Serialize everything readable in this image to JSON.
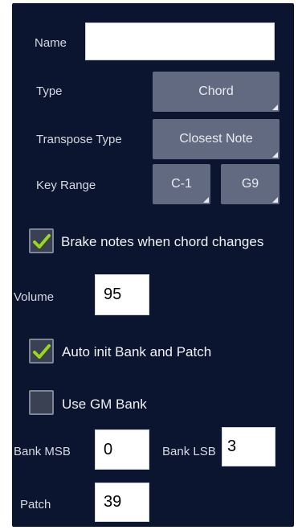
{
  "fields": {
    "name_label": "Name",
    "name_value": "",
    "type_label": "Type",
    "type_value": "Chord",
    "transpose_label": "Transpose Type",
    "transpose_value": "Closest Note",
    "key_range_label": "Key Range",
    "key_range_low": "C-1",
    "key_range_high": "G9"
  },
  "options": {
    "brake_notes_label": "Brake notes when chord changes",
    "brake_notes_checked": true,
    "auto_init_label": "Auto init Bank and Patch",
    "auto_init_checked": true,
    "use_gm_label": "Use GM Bank",
    "use_gm_checked": false
  },
  "values": {
    "volume_label": "Volume",
    "volume_value": "95",
    "bank_msb_label": "Bank MSB",
    "bank_msb_value": "0",
    "bank_lsb_label": "Bank LSB",
    "bank_lsb_value": "3",
    "patch_label": "Patch",
    "patch_value": "39"
  },
  "colors": {
    "panel_bg": "#0b1530",
    "button_bg": "#616a80",
    "check_accent": "#9ad818"
  }
}
